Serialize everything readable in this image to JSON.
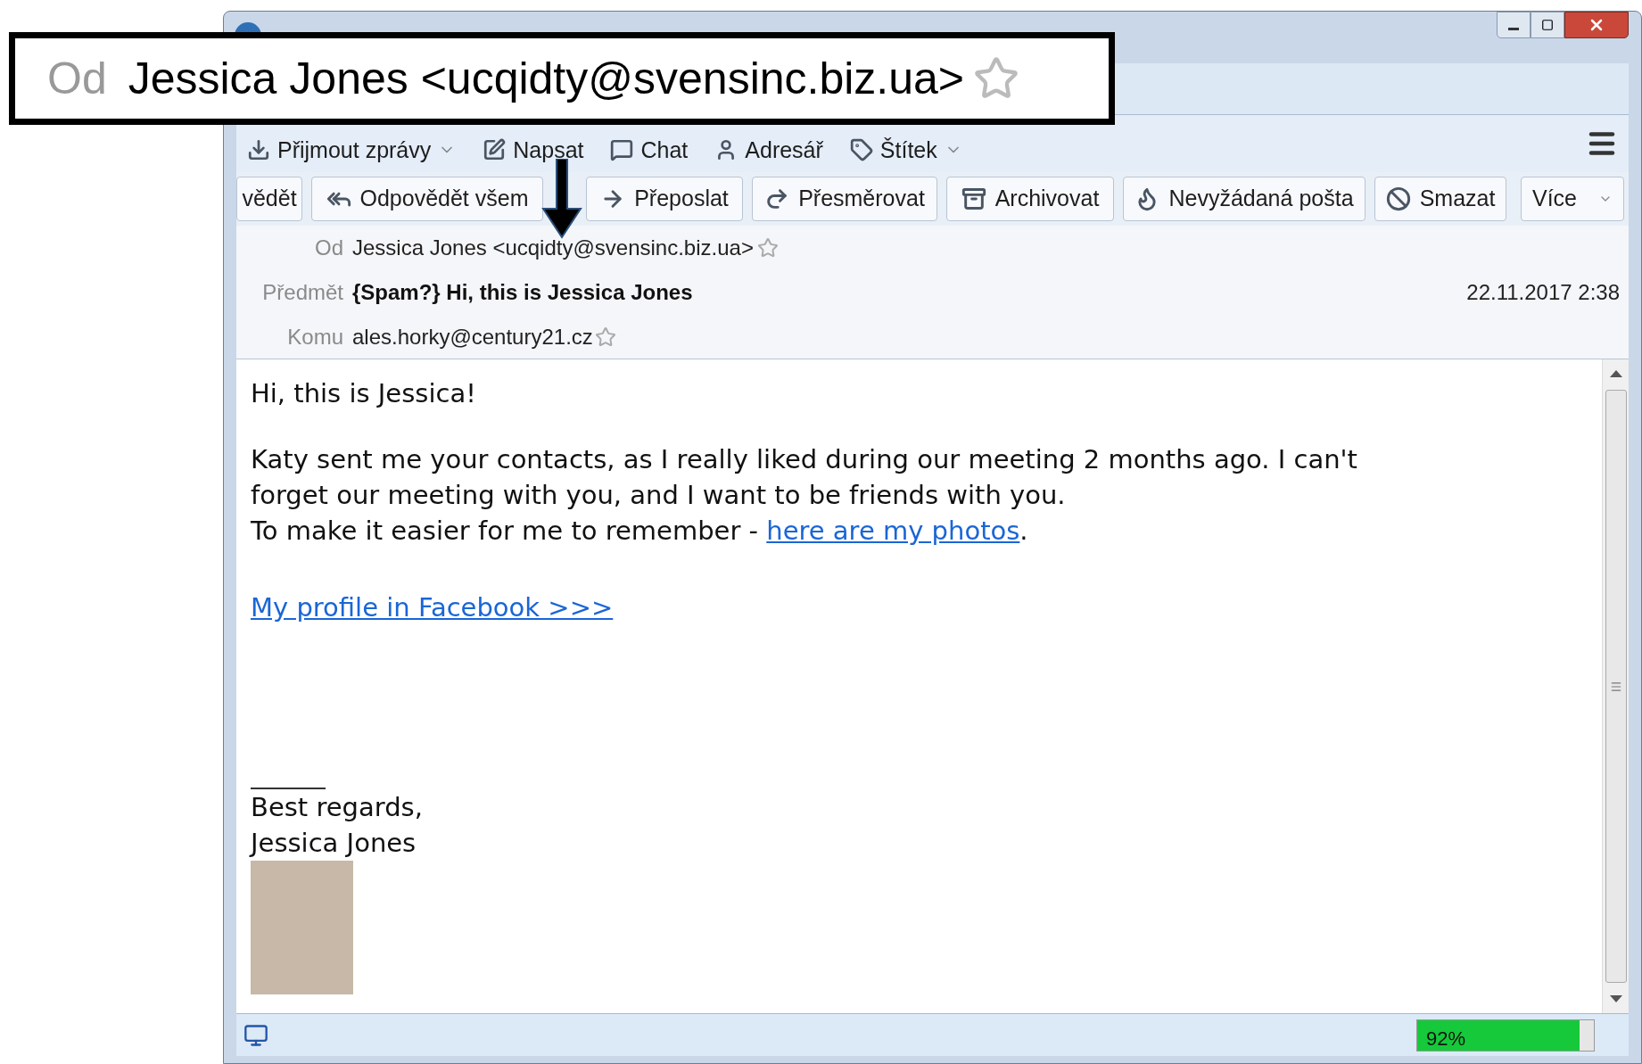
{
  "callout": {
    "label": "Od",
    "sender": "Jessica Jones <ucqidty@svensinc.biz.ua>"
  },
  "toolbar": [
    {
      "label": "Přijmout zprávy",
      "dropdown": true
    },
    {
      "label": "Napsat",
      "dropdown": false
    },
    {
      "label": "Chat",
      "dropdown": false
    },
    {
      "label": "Adresář",
      "dropdown": false
    },
    {
      "label": "Štítek",
      "dropdown": true
    }
  ],
  "actions": [
    {
      "label": "vědět",
      "dropdown": false
    },
    {
      "label": "Odpovědět všem",
      "dropdown": false
    },
    {
      "label": "Přeposlat",
      "dropdown": false
    },
    {
      "label": "Přesměrovat",
      "dropdown": false
    },
    {
      "label": "Archivovat",
      "dropdown": false
    },
    {
      "label": "Nevyžádaná pošta",
      "dropdown": false
    },
    {
      "label": "Smazat",
      "dropdown": false
    },
    {
      "label": "Více",
      "dropdown": true
    }
  ],
  "header": {
    "from_label": "Od",
    "from": "Jessica Jones <ucqidty@svensinc.biz.ua>",
    "subject_label": "Předmět",
    "subject": "{Spam?} Hi, this is Jessica Jones",
    "date": "22.11.2017 2:38",
    "to_label": "Komu",
    "to": "ales.horky@century21.cz"
  },
  "body": [
    {
      "kind": "text",
      "lines": [
        "Hi, this is Jessica!"
      ]
    },
    {
      "kind": "text",
      "lines": [
        "Katy sent me your contacts, as I really liked during our meeting 2 months ago. I can't",
        "forget our meeting with you, and I want to be friends with you."
      ]
    },
    {
      "kind": "linkline",
      "before": "To make it easier for me to remember - ",
      "link": "here are my photos",
      "after": "."
    },
    {
      "kind": "link",
      "text": "My profile in Facebook >>>"
    }
  ],
  "signature": {
    "lines": [
      "Best regards,",
      "Jessica Jones"
    ]
  },
  "status": {
    "level": 0.92,
    "reading": "92%"
  }
}
